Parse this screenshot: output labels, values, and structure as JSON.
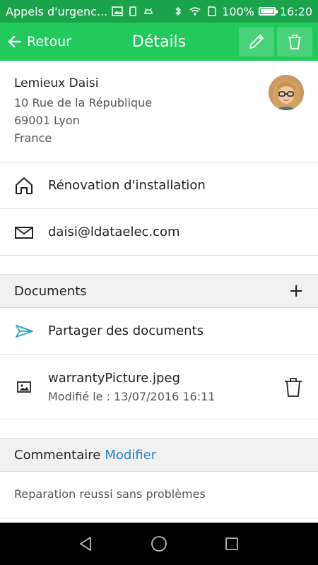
{
  "status_bar": {
    "notification_text": "Appels d'urgenc...",
    "battery_percent": "100%",
    "battery_level": 1.0,
    "time": "16:20",
    "icons": [
      "screenshot-icon",
      "sim-icon",
      "android-icon",
      "bluetooth-icon",
      "wifi-icon",
      "sd-card-icon",
      "battery-icon"
    ]
  },
  "app_bar": {
    "back_label": "Retour",
    "title": "Détails",
    "icons": [
      "arrow-left-icon",
      "pencil-icon",
      "trash-icon"
    ]
  },
  "contact": {
    "name": "Lemieux Daisi",
    "address_line1": "10 Rue de la République",
    "address_line2": "69001 Lyon",
    "country": "France"
  },
  "project": {
    "label": "Rénovation d'installation",
    "icon": "home-icon"
  },
  "email": {
    "value": "daisi@ldataelec.com",
    "icon": "envelope-icon"
  },
  "documents": {
    "header": "Documents",
    "add_label": "+",
    "share_label": "Partager des documents",
    "files": [
      {
        "name": "warrantyPicture.jpeg",
        "modified": "Modifié le : 13/07/2016 16:11",
        "icon": "image-icon"
      }
    ]
  },
  "comment": {
    "header": "Commentaire",
    "edit_label": "Modifier",
    "text": "Reparation reussi sans problèmes"
  },
  "colors": {
    "app_bar": "#22c95c",
    "status_bar": "#1aa34a",
    "share_accent": "#22a9c7",
    "link_blue": "#2d7fc6"
  },
  "nav_bar": {
    "icons": [
      "back-triangle-icon",
      "home-circle-icon",
      "recents-square-icon"
    ]
  }
}
